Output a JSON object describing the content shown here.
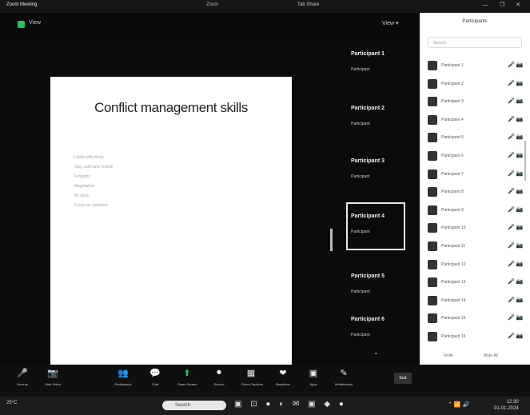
{
  "window": {
    "app": "Zoom Meeting",
    "title": "Zoom",
    "activity": "Tab Share",
    "controls": "— ❐ ✕"
  },
  "infobar": {
    "view_label": "View",
    "view_btn": "View ▾"
  },
  "slide": {
    "title": "Conflict management skills",
    "bullets": [
      "Listen effectively",
      "Stay calm and neutral",
      "Empathy",
      "Negotiation",
      "Be open",
      "Focus on solutions"
    ]
  },
  "tiles": [
    {
      "name": "Participant 1",
      "sub": "Participant",
      "selected": false
    },
    {
      "name": "Participant 2",
      "sub": "Participant",
      "selected": false
    },
    {
      "name": "Participant 3",
      "sub": "Participant",
      "selected": false
    },
    {
      "name": "Participant 4",
      "sub": "Participant",
      "selected": true
    },
    {
      "name": "Participant 5",
      "sub": "Participant",
      "selected": false
    },
    {
      "name": "Participant 6",
      "sub": "Participant",
      "selected": false
    }
  ],
  "panel": {
    "title": "Participants",
    "search": "Search",
    "participants": [
      {
        "name": "Participant 1",
        "icons": "🎤 📷"
      },
      {
        "name": "Participant 2",
        "icons": "🎤 📷"
      },
      {
        "name": "Participant 3",
        "icons": "🎤 📷"
      },
      {
        "name": "Participant 4",
        "icons": "🎤 📷"
      },
      {
        "name": "Participant 5",
        "icons": "🎤 📷"
      },
      {
        "name": "Participant 6",
        "icons": "🎤 📷"
      },
      {
        "name": "Participant 7",
        "icons": "🎤 📷"
      },
      {
        "name": "Participant 8",
        "icons": "🎤 📷"
      },
      {
        "name": "Participant 9",
        "icons": "🎤 📷"
      },
      {
        "name": "Participant 10",
        "icons": "🎤 📷"
      },
      {
        "name": "Participant 11",
        "icons": "🎤 📷"
      },
      {
        "name": "Participant 12",
        "icons": "🎤 📷"
      },
      {
        "name": "Participant 13",
        "icons": "🎤 📷"
      },
      {
        "name": "Participant 14",
        "icons": "🎤 📷"
      },
      {
        "name": "Participant 15",
        "icons": "🎤 📷"
      },
      {
        "name": "Participant 16",
        "icons": "🎤 📷"
      }
    ],
    "footer_left": "Invite",
    "footer_right": "Mute All"
  },
  "controls": [
    {
      "icon": "🎤",
      "label": "Unmute"
    },
    {
      "icon": "📷",
      "label": "Start Video"
    },
    {
      "icon": "👥",
      "label": "Participants"
    },
    {
      "icon": "💬",
      "label": "Chat"
    },
    {
      "icon": "⬆",
      "label": "Share Screen"
    },
    {
      "icon": "⏺",
      "label": "Record"
    },
    {
      "icon": "▦",
      "label": "Show Captions"
    },
    {
      "icon": "❤",
      "label": "Reactions"
    },
    {
      "icon": "▣",
      "label": "Apps"
    },
    {
      "icon": "✎",
      "label": "Whiteboards"
    }
  ],
  "leave_label": "End",
  "taskbar": {
    "weather": "25°C",
    "search": "Search",
    "apps": "▣ ⊡ ● ◐ ✉ ▣ ◆ ●",
    "tray": "⌃ 📶 🔊",
    "time": "12:30",
    "date": "01-01-2024"
  }
}
